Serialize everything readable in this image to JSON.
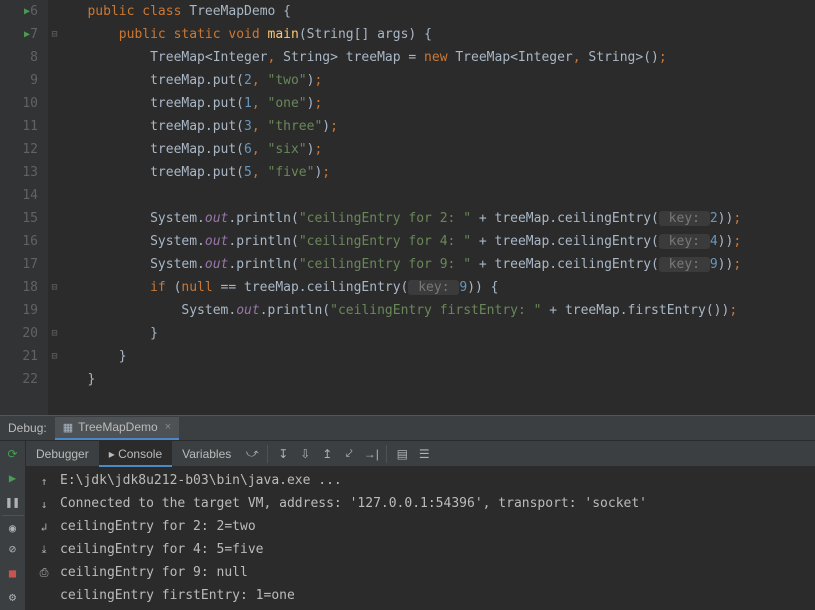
{
  "gutter": {
    "lines": [
      6,
      7,
      8,
      9,
      10,
      11,
      12,
      13,
      14,
      15,
      16,
      17,
      18,
      19,
      20,
      21,
      22
    ]
  },
  "code": {
    "l6": {
      "kw1": "public",
      "kw2": "class",
      "cls": "TreeMapDemo",
      "brace": " {"
    },
    "l7": {
      "kw1": "public",
      "kw2": "static",
      "kw3": "void",
      "method": "main",
      "params": "(String[] args) {"
    },
    "l8": {
      "type1": "TreeMap<Integer",
      "c1": ",",
      "type2": " String> treeMap = ",
      "kw": "new",
      "ctor": " TreeMap<Integer",
      "c2": ",",
      "ctor2": " String>()",
      "semi": ";"
    },
    "l9": {
      "call": "treeMap.put(",
      "n": "2",
      "c": ",",
      "sp": " ",
      "s": "\"two\"",
      "end": ")",
      "semi": ";"
    },
    "l10": {
      "call": "treeMap.put(",
      "n": "1",
      "c": ",",
      "sp": " ",
      "s": "\"one\"",
      "end": ")",
      "semi": ";"
    },
    "l11": {
      "call": "treeMap.put(",
      "n": "3",
      "c": ",",
      "sp": " ",
      "s": "\"three\"",
      "end": ")",
      "semi": ";"
    },
    "l12": {
      "call": "treeMap.put(",
      "n": "6",
      "c": ",",
      "sp": " ",
      "s": "\"six\"",
      "end": ")",
      "semi": ";"
    },
    "l13": {
      "call": "treeMap.put(",
      "n": "5",
      "c": ",",
      "sp": " ",
      "s": "\"five\"",
      "end": ")",
      "semi": ";"
    },
    "l15": {
      "sys": "System.",
      "out": "out",
      "pr": ".println(",
      "s": "\"ceilingEntry for 2: \"",
      "plus": " + treeMap.ceilingEntry(",
      "hint": " key: ",
      "n": "2",
      "end": "))",
      "semi": ";"
    },
    "l16": {
      "sys": "System.",
      "out": "out",
      "pr": ".println(",
      "s": "\"ceilingEntry for 4: \"",
      "plus": " + treeMap.ceilingEntry(",
      "hint": " key: ",
      "n": "4",
      "end": "))",
      "semi": ";"
    },
    "l17": {
      "sys": "System.",
      "out": "out",
      "pr": ".println(",
      "s": "\"ceilingEntry for 9: \"",
      "plus": " + treeMap.ceilingEntry(",
      "hint": " key: ",
      "n": "9",
      "end": "))",
      "semi": ";"
    },
    "l18": {
      "kw": "if",
      "open": " (",
      "nul": "null",
      "eq": " == treeMap.ceilingEntry(",
      "hint": " key: ",
      "n": "9",
      "end": ")) {"
    },
    "l19": {
      "sys": "System.",
      "out": "out",
      "pr": ".println(",
      "s": "\"ceilingEntry firstEntry: \"",
      "plus": " + treeMap.firstEntry())",
      "semi": ";"
    },
    "l20": {
      "brace": "}"
    },
    "l21": {
      "brace": "}"
    },
    "l22": {
      "brace": "}"
    }
  },
  "debug": {
    "label": "Debug:",
    "tabName": "TreeMapDemo",
    "tabs": {
      "debugger": "Debugger",
      "console": "Console",
      "variables": "Variables"
    },
    "output": [
      "E:\\jdk\\jdk8u212-b03\\bin\\java.exe ...",
      "Connected to the target VM, address: '127.0.0.1:54396', transport: 'socket'",
      "ceilingEntry for 2: 2=two",
      "ceilingEntry for 4: 5=five",
      "ceilingEntry for 9: null",
      "ceilingEntry firstEntry: 1=one"
    ]
  }
}
